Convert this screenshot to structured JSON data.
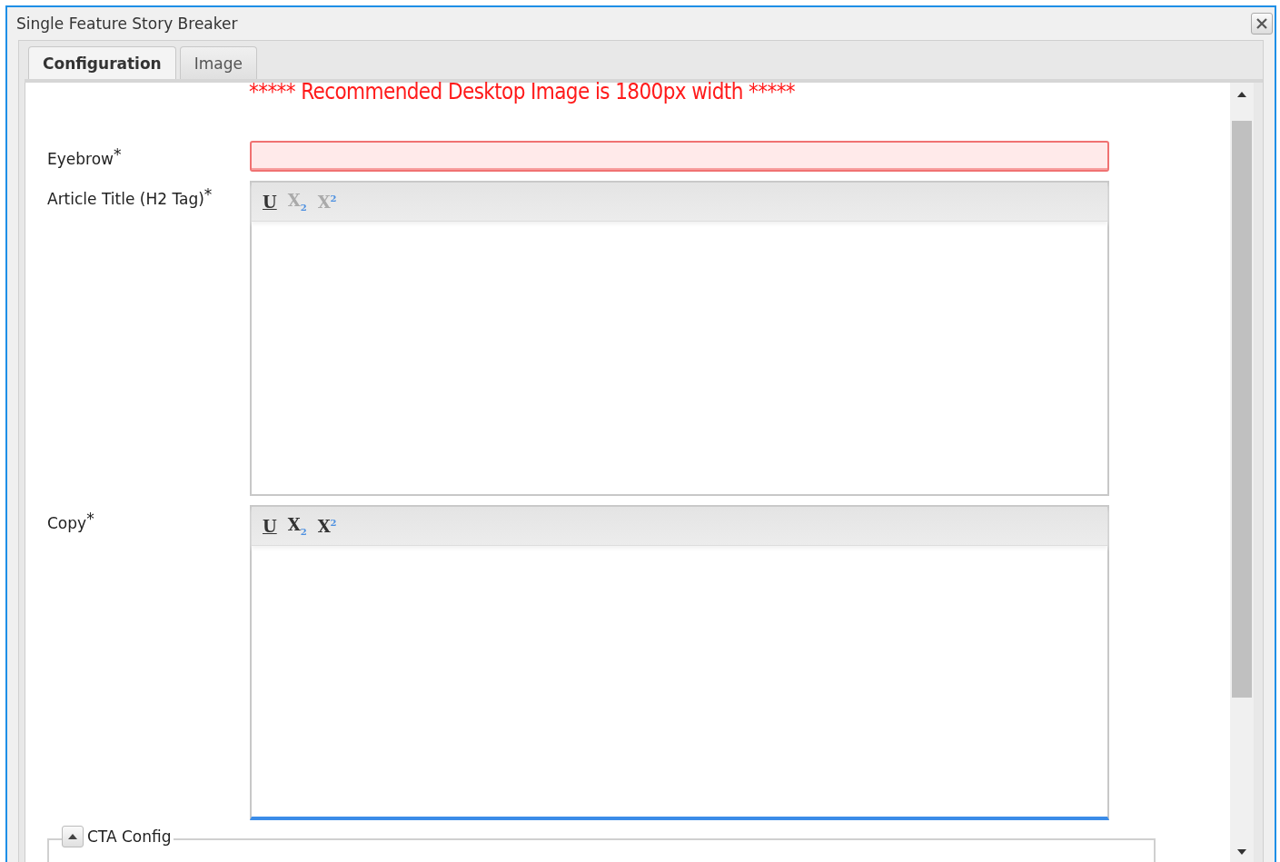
{
  "window": {
    "title": "Single Feature Story Breaker"
  },
  "tabs": [
    {
      "label": "Configuration",
      "selected": true
    },
    {
      "label": "Image",
      "selected": false
    }
  ],
  "notice": "***** Recommended Desktop Image is 1800px width *****",
  "fields": [
    {
      "kind": "text",
      "label": "Eyebrow",
      "required_mark": "*",
      "invalid": true,
      "focused": false
    },
    {
      "kind": "richtext",
      "label": "Article Title (H2 Tag)",
      "required_mark": "*",
      "invalid": false,
      "focused": false,
      "toolbar": [
        {
          "label": "U",
          "disabled": false
        },
        {
          "label": "X$_{2}$",
          "disabled": true
        },
        {
          "label": "X$^{2}$",
          "disabled": true
        }
      ]
    },
    {
      "kind": "richtext",
      "label": "Copy",
      "required_mark": "*",
      "invalid": false,
      "focused": true,
      "toolbar": [
        {
          "label": "U",
          "disabled": false
        },
        {
          "label": "X$_{2}$",
          "disabled": false
        },
        {
          "label": "X$^{2}$",
          "disabled": false
        }
      ]
    }
  ],
  "fieldset": {
    "title": "CTA Config",
    "expanded": true
  }
}
